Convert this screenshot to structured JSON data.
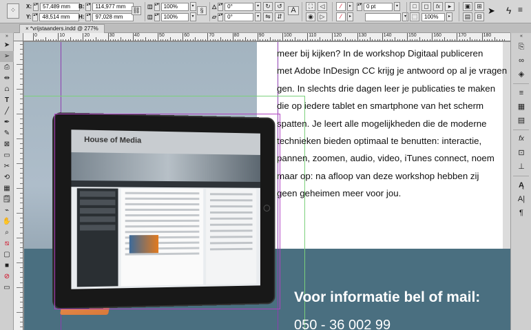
{
  "control_panel": {
    "x_label": "X:",
    "x_value": "57,489 mm",
    "y_label": "Y:",
    "y_value": "48,514 mm",
    "w_label": "B:",
    "w_value": "114,977 mm",
    "h_label": "H:",
    "h_value": "97,028 mm",
    "scale_x": "100%",
    "scale_y": "100%",
    "rotate": "0°",
    "shear": "0°",
    "stroke_weight": "0 pt",
    "opacity": "100%"
  },
  "document_tab": {
    "close": "×",
    "title": "*vrijstaanders.indd @ 277%"
  },
  "ruler": {
    "h_labels": [
      "0",
      "10",
      "20",
      "30",
      "40",
      "50",
      "60",
      "70",
      "80",
      "90",
      "100",
      "110",
      "120",
      "130",
      "140",
      "150",
      "160",
      "170",
      "180"
    ]
  },
  "body_text": [
    "meer bij kijken? In de workshop Digitaal publiceren",
    "met Adobe InDesign CC krijg je antwoord op al je vragen.",
    "gen. In slechts drie dagen leer je publicaties te maken",
    "die op iedere tablet en smartphone van het scherm",
    "spatten. Je leert alle mogelijkheden die de moderne",
    "technieken bieden optimaal te benutten: interactie,",
    "pannen, zoomen, audio, video, iTunes connect, noem",
    "maar op: na afloop van deze workshop hebben zij",
    "geen geheimen meer voor jou."
  ],
  "contact": {
    "heading": "Voor informatie bel of mail:",
    "phone": "050 - 36 002 99"
  },
  "tablet_screen": {
    "logo": "House of Media"
  }
}
